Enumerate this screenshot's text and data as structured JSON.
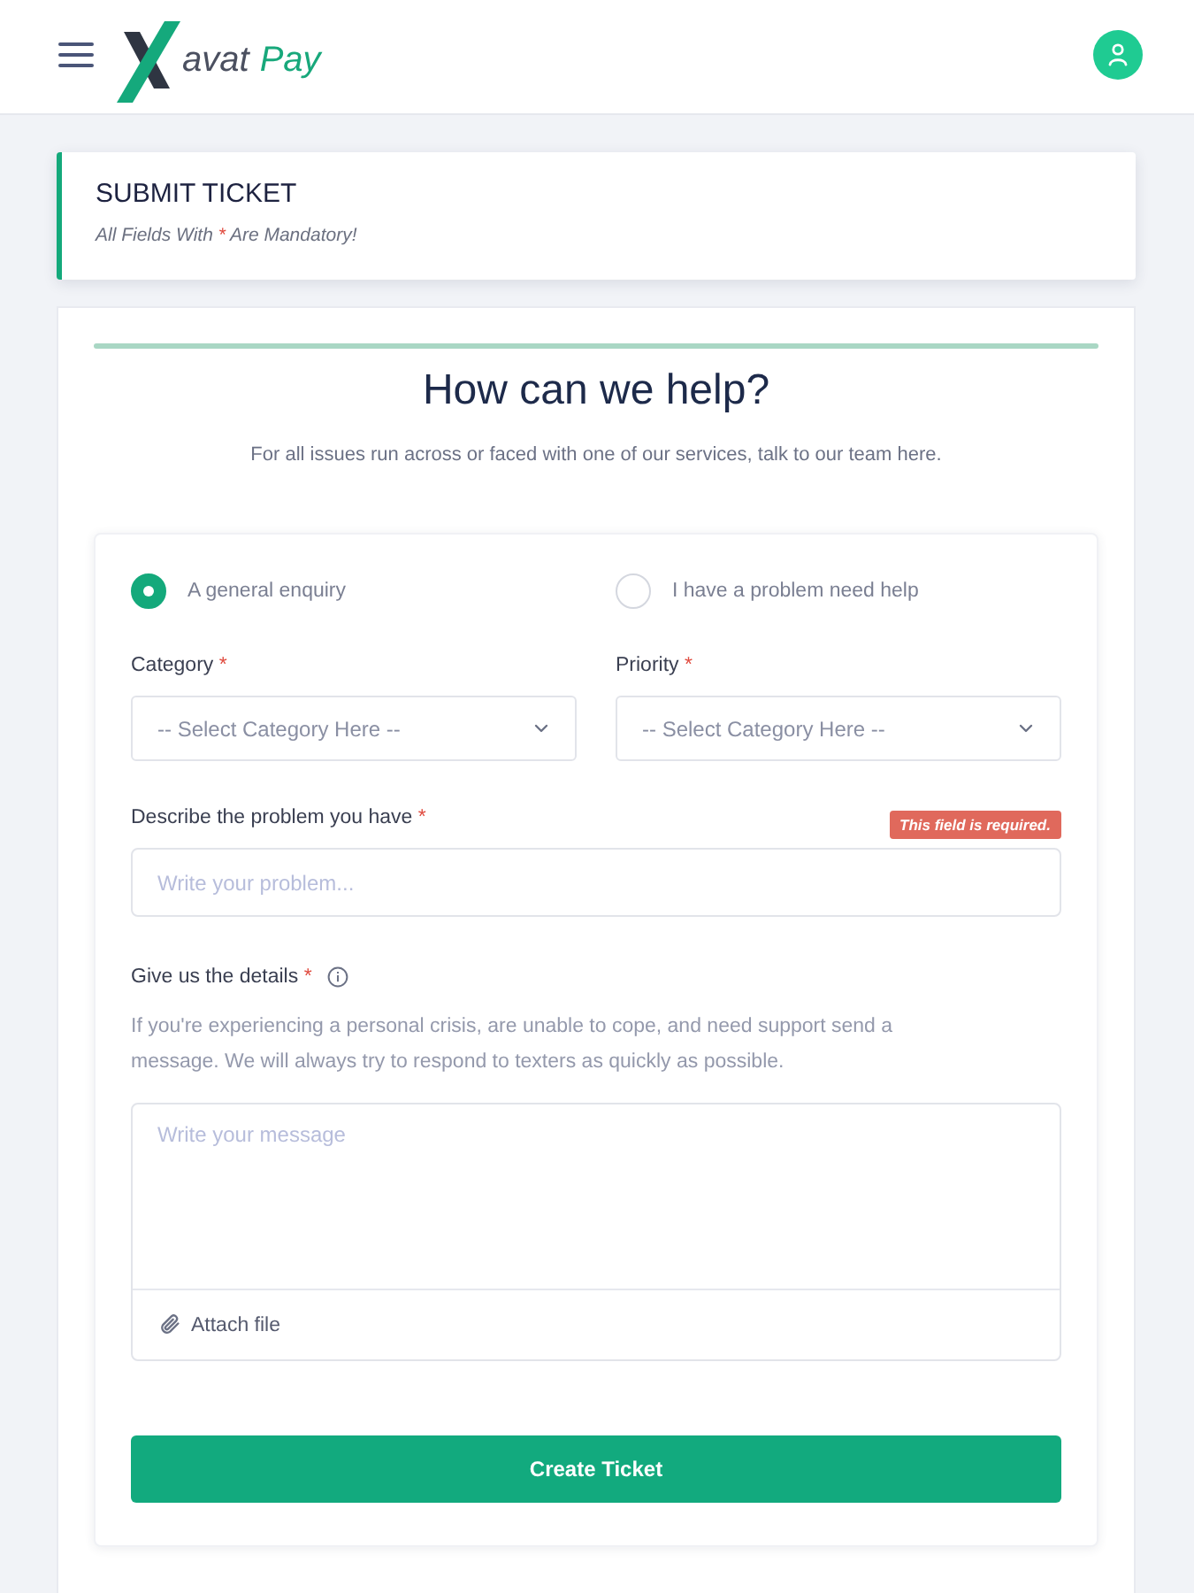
{
  "header": {
    "logo": {
      "name": "avat",
      "accent": "Pay"
    }
  },
  "title_card": {
    "title": "SUBMIT TICKET",
    "note": {
      "before": "All Fields With",
      "mark": "*",
      "after": "Are Mandatory!"
    }
  },
  "help": {
    "heading": "How can we help?",
    "intro": "For all issues run across or faced with one of our services, talk to our team here."
  },
  "enquiry_types": [
    {
      "label": "A general enquiry",
      "selected": true
    },
    {
      "label": "I have a problem need help",
      "selected": false
    }
  ],
  "selects": [
    {
      "label": "Category",
      "required_mark": "*",
      "placeholder": "-- Select Category Here --"
    },
    {
      "label": "Priority",
      "required_mark": "*",
      "placeholder": "-- Select Category Here --"
    }
  ],
  "problem": {
    "label": "Describe the problem you have",
    "required_mark": "*",
    "placeholder": "Write your problem...",
    "error": "This field is required."
  },
  "details": {
    "label": "Give us the details",
    "required_mark": "*",
    "hint": "If you're experiencing a personal crisis, are unable to cope, and need support send a message. We will always try to respond to texters as quickly as possible.",
    "placeholder": "Write your message",
    "attach_label": "Attach file"
  },
  "submit": {
    "label": "Create Ticket"
  }
}
